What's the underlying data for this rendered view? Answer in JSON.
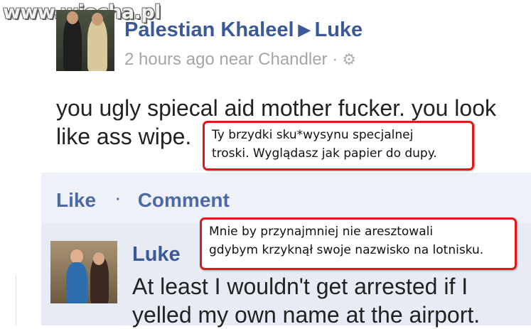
{
  "watermark": "www.wiocha.pl",
  "post": {
    "author": "Palestian Khaleel",
    "target": "Luke",
    "meta": "2 hours ago near Chandler ·",
    "text_line1": "you ugly spiecal aid mother fucker. you look",
    "text_line2": "like ass wipe.",
    "translation_line1": "Ty brzydki sku*wysynu specjalnej",
    "translation_line2": "troski. Wyglądasz jak papier do dupy."
  },
  "actions": {
    "like": "Like",
    "separator": "·",
    "comment": "Comment"
  },
  "comment": {
    "author": "Luke",
    "text_line1": "At least I wouldn't get arrested if I",
    "text_line2": "yelled my own name at the airport.",
    "translation_line1": "Mnie by przynajmniej nie aresztowali",
    "translation_line2": "gdybym krzyknął swoje nazwisko na lotnisku."
  },
  "colors": {
    "link_blue": "#3b5998",
    "annotation_red": "#e01818",
    "action_bg": "#eef1f8",
    "comment_bg": "#e7ebf3"
  },
  "icons": {
    "gear": "gear-icon",
    "arrow": "triangle-right-icon"
  }
}
